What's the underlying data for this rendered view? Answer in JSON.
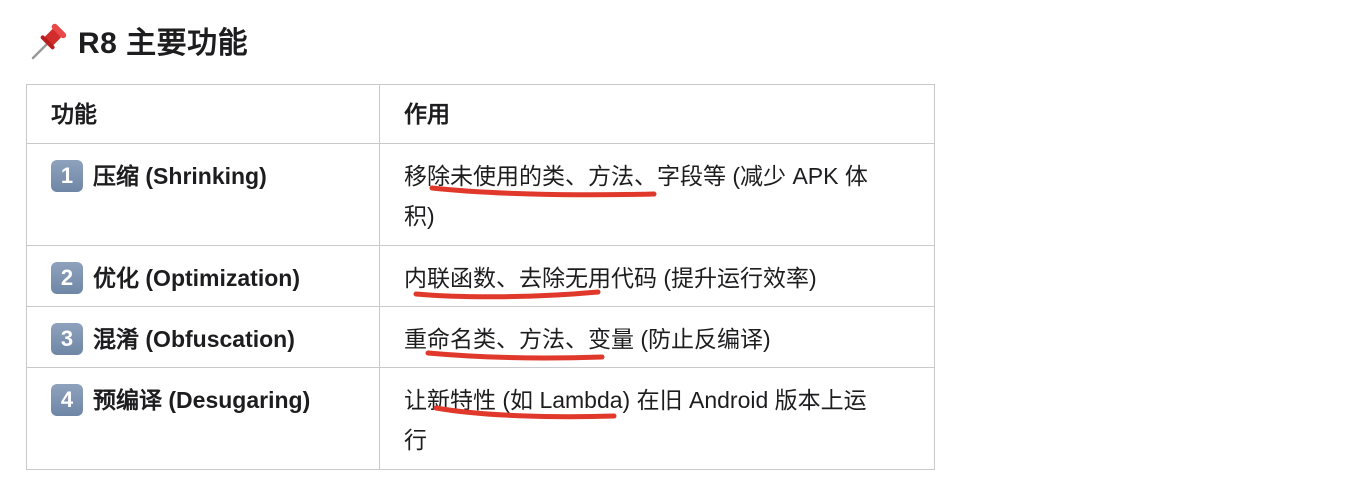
{
  "heading": {
    "icon": "pushpin-icon",
    "title": "R8 主要功能"
  },
  "table": {
    "headers": {
      "feature": "功能",
      "effect": "作用"
    },
    "rows": [
      {
        "number": "1",
        "feature": "压缩 (Shrinking)",
        "effect": "移除未使用的类、方法、字段等 (减少 APK 体积)"
      },
      {
        "number": "2",
        "feature": "优化 (Optimization)",
        "effect": "内联函数、去除无用代码 (提升运行效率)"
      },
      {
        "number": "3",
        "feature": "混淆 (Obfuscation)",
        "effect": "重命名类、方法、变量 (防止反编译)"
      },
      {
        "number": "4",
        "feature": "预编译 (Desugaring)",
        "effect": "让新特性 (如 Lambda) 在旧 Android 版本上运行"
      }
    ]
  },
  "colors": {
    "border": "#c9c9c9",
    "text": "#1d1d1f",
    "number_badge": "#7d92b1",
    "annotation_red": "#e0392b"
  }
}
